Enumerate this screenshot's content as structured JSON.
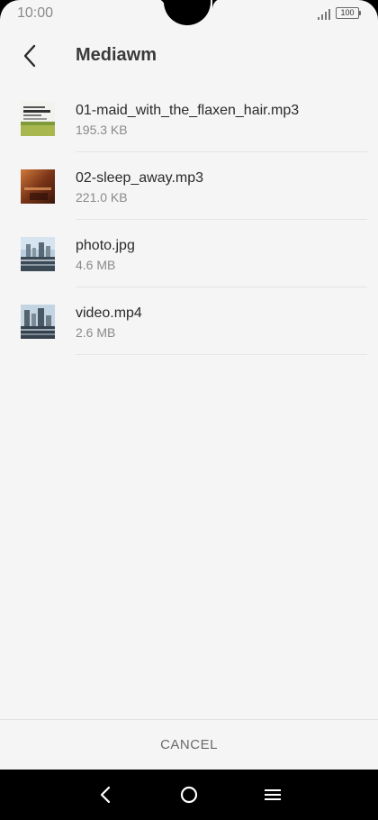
{
  "status_bar": {
    "time": "10:00",
    "battery": "100",
    "signal_icon": "signal-bars-icon"
  },
  "header": {
    "title": "Mediawm",
    "back_icon": "chevron-left-icon"
  },
  "files": [
    {
      "name": "01-maid_with_the_flaxen_hair.mp3",
      "size": "195.3 KB",
      "thumb": "album-art-green"
    },
    {
      "name": "02-sleep_away.mp3",
      "size": "221.0 KB",
      "thumb": "album-art-brown"
    },
    {
      "name": "photo.jpg",
      "size": "4.6 MB",
      "thumb": "city-photo"
    },
    {
      "name": "video.mp4",
      "size": "2.6 MB",
      "thumb": "city-video"
    }
  ],
  "footer": {
    "cancel_label": "CANCEL"
  },
  "nav_bar": {
    "back_icon": "triangle-back-icon",
    "home_icon": "circle-home-icon",
    "menu_icon": "hamburger-menu-icon"
  }
}
